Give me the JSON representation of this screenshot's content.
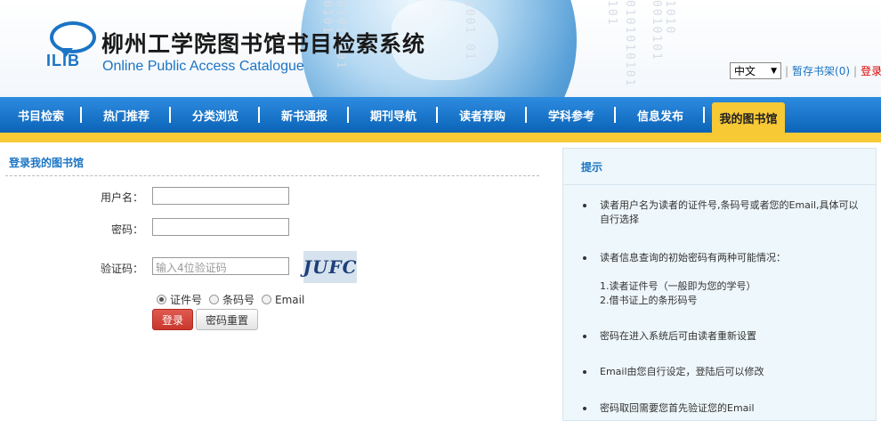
{
  "header": {
    "title": "柳州工学院图书馆书目检索系统",
    "subtitle": "Online Public Access Catalogue",
    "logo_text": "ILIB",
    "lang_select": "中文",
    "links": {
      "shelf": "暂存书架(0)",
      "login": "登录",
      "sep": "|"
    }
  },
  "nav": {
    "items": [
      {
        "label": "书目检索"
      },
      {
        "label": "热门推荐"
      },
      {
        "label": "分类浏览"
      },
      {
        "label": "新书通报"
      },
      {
        "label": "期刊导航"
      },
      {
        "label": "读者荐购"
      },
      {
        "label": "学科参考"
      },
      {
        "label": "信息发布"
      },
      {
        "label": "我的图书馆"
      }
    ]
  },
  "login": {
    "title": "登录我的图书馆",
    "username_label": "用户名：",
    "password_label": "密码：",
    "captcha_label": "验证码：",
    "captcha_placeholder": "输入4位验证码",
    "captcha_text": "JUFC",
    "radio_options": [
      "证件号",
      "条码号",
      "Email"
    ],
    "login_button": "登录",
    "reset_button": "密码重置"
  },
  "tips": {
    "title": "提示",
    "items": [
      "读者用户名为读者的证件号,条码号或者您的Email,具体可以自行选择",
      "读者信息查询的初始密码有两种可能情况：",
      "1.读者证件号（一般即为您的学号）",
      "2.借书证上的条形码号",
      "密码在进入系统后可由读者重新设置",
      "Email由您自行设定，登陆后可以修改",
      "密码取回需要您首先验证您的Email"
    ]
  },
  "colors": {
    "accent": "#1b74c4",
    "nav": "#0b63b8",
    "highlight": "#f7c935",
    "danger": "#c8372c"
  }
}
